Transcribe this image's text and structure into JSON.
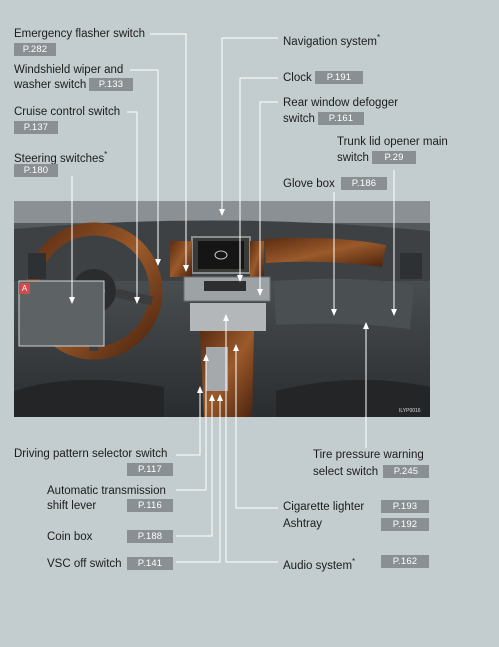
{
  "labels": {
    "emergency_flasher": {
      "text": "Emergency flasher switch",
      "page": "P.282"
    },
    "wiper_line1": "Windshield wiper and",
    "wiper_line2": "washer switch",
    "wiper_page": "P.133",
    "cruise": {
      "text": "Cruise control switch",
      "page": "P.137"
    },
    "steering": {
      "text": "Steering switches",
      "star": "*",
      "page": "P.180"
    },
    "navigation": {
      "text": "Navigation system",
      "star": "*"
    },
    "clock": {
      "text": "Clock",
      "page": "P.191"
    },
    "rear_defogger_line1": "Rear window defogger",
    "rear_defogger_line2": "switch",
    "rear_defogger_page": "P.161",
    "trunk_line1": "Trunk lid opener main",
    "trunk_line2": "switch",
    "trunk_page": "P.29",
    "glove_box": {
      "text": "Glove box",
      "page": "P.186"
    },
    "driving_pattern": {
      "text": "Driving pattern selector switch",
      "page": "P.117"
    },
    "auto_trans_line1": "Automatic  transmission",
    "auto_trans_line2": "shift lever",
    "auto_trans_page": "P.116",
    "coin_box": {
      "text": "Coin box",
      "page": "P.188"
    },
    "vsc_off": {
      "text": "VSC off switch",
      "page": "P.141"
    },
    "tire_line1": "Tire pressure warning",
    "tire_line2": "select switch",
    "tire_page": "P.245",
    "cigarette": {
      "text": "Cigarette lighter",
      "page": "P.193"
    },
    "ashtray": {
      "text": "Ashtray",
      "page": "P.192"
    },
    "audio": {
      "text": "Audio system",
      "star": "*",
      "page": "P.162"
    }
  },
  "photo": {
    "badge": "A",
    "code": "ILYP0016"
  }
}
